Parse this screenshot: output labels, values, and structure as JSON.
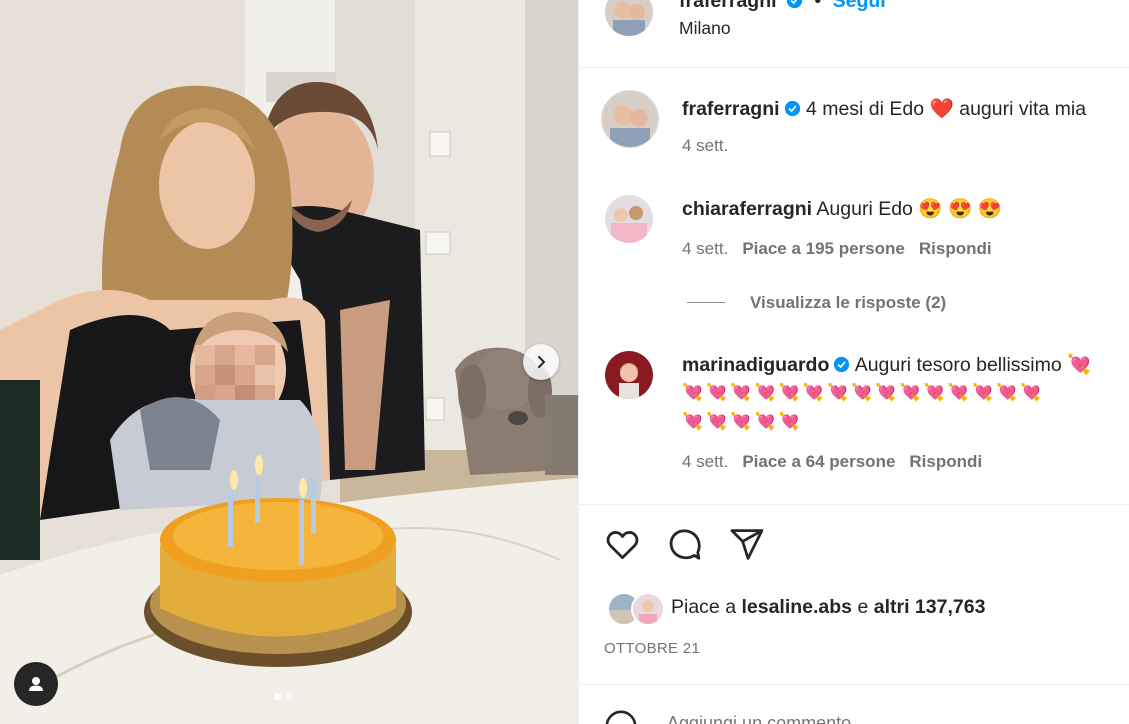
{
  "header": {
    "username": "fraferragni",
    "follow_label": "Segui",
    "location": "Milano"
  },
  "caption": {
    "username": "fraferragni",
    "text_before": "4 mesi di Edo",
    "text_after": "auguri vita mia",
    "time": "4 sett."
  },
  "comments": [
    {
      "username": "chiaraferragni",
      "text": "Auguri Edo",
      "emoji": "😍 😍 😍",
      "time": "4 sett.",
      "likes": "Piace a 195 persone",
      "reply_label": "Rispondi",
      "view_replies": "Visualizza le risposte (2)"
    },
    {
      "username": "marinadiguardo",
      "text": "Auguri tesoro bellissimo",
      "emoji_line_1": "💘💘💘💘💘💘💘💘💘💘💘💘💘💘💘",
      "emoji_line_2": "💘💘💘💘💘",
      "time": "4 sett.",
      "likes": "Piace a 64 persone",
      "reply_label": "Rispondi"
    }
  ],
  "likes": {
    "prefix": "Piace a",
    "user": "lesaline.abs",
    "conj": "e",
    "others": "altri 137,763"
  },
  "date": "OTTOBRE 21",
  "add_comment_placeholder": "Aggiungi un commento...",
  "colors": {
    "accent": "#0095f6",
    "verified": "#0095f6",
    "heart": "#ed4956",
    "text_secondary": "#737373"
  },
  "icons": [
    "chevron-right-icon",
    "user-tag-icon",
    "heart-icon",
    "comment-icon",
    "share-icon",
    "verified-icon"
  ]
}
